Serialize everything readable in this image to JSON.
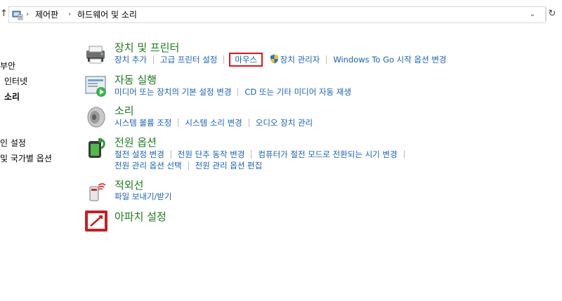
{
  "address": {
    "crumbs": [
      "제어판",
      "하드웨어 및 소리"
    ]
  },
  "leftnav": {
    "items": [
      "부안",
      "인터넷",
      "소리",
      "인 설정",
      "및 국가별 옵션"
    ]
  },
  "categories": {
    "devices": {
      "title": "장치 및 프린터",
      "links": [
        "장치 추가",
        "고급 프린터 설정",
        "마우스",
        "장치 관리자",
        "Windows To Go 시작 옵션 변경"
      ]
    },
    "autoplay": {
      "title": "자동 실행",
      "links": [
        "미디어 또는 장치의 기본 설정 변경",
        "CD 또는 기타 미디어 자동 재생"
      ]
    },
    "sound": {
      "title": "소리",
      "links": [
        "시스템 볼륨 조정",
        "시스템 소리 변경",
        "오디오 장치 관리"
      ]
    },
    "power": {
      "title": "전원 옵션",
      "links_row1": [
        "절전 설정 변경",
        "전원 단추 동작 변경",
        "컴퓨터가 절전 모드로 전환되는 시기 변경"
      ],
      "links_row2": [
        "전원 관리 옵션 선택",
        "전원 관리 옵션 편집"
      ]
    },
    "infrared": {
      "title": "적외선",
      "links": [
        "파일 보내기/받기"
      ]
    },
    "apache": {
      "title": "아파치 설정"
    }
  },
  "colors": {
    "title_green": "#1e7a1e",
    "link_blue": "#1a5fb4",
    "highlight_red": "#e0141c"
  }
}
